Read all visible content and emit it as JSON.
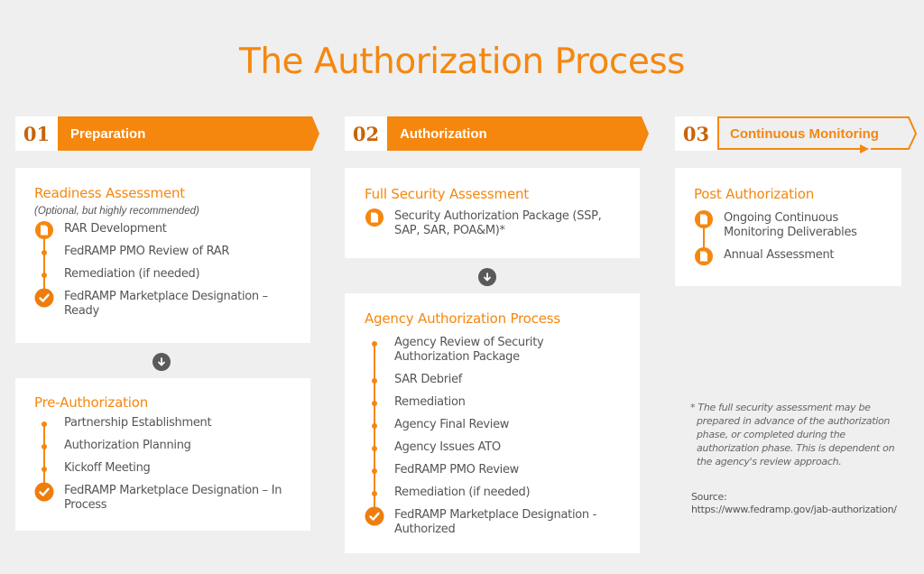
{
  "title": "The Authorization Process",
  "colors": {
    "accent": "#f5870f",
    "number": "#c8640a",
    "arrow": "#5a5a5a",
    "background": "#efefef"
  },
  "phases": [
    {
      "number": "01",
      "label": "Preparation",
      "style": "filled"
    },
    {
      "number": "02",
      "label": "Authorization",
      "style": "filled"
    },
    {
      "number": "03",
      "label": "Continuous Monitoring",
      "style": "outline"
    }
  ],
  "cards": {
    "readiness": {
      "title": "Readiness Assessment",
      "subtitle": "(Optional, but highly recommended)",
      "items": [
        {
          "icon": "document-icon",
          "text": "RAR Development"
        },
        {
          "icon": "dot-icon",
          "text": "FedRAMP PMO Review of RAR"
        },
        {
          "icon": "dot-icon",
          "text": "Remediation (if needed)"
        },
        {
          "icon": "check-icon",
          "text": "FedRAMP Marketplace Designation – Ready"
        }
      ]
    },
    "pre_authorization": {
      "title": "Pre-Authorization",
      "items": [
        {
          "icon": "dot-icon",
          "text": "Partnership Establishment"
        },
        {
          "icon": "dot-icon",
          "text": "Authorization Planning"
        },
        {
          "icon": "dot-icon",
          "text": "Kickoff Meeting"
        },
        {
          "icon": "check-icon",
          "text": "FedRAMP Marketplace Designation – In Process"
        }
      ]
    },
    "full_security": {
      "title": "Full Security Assessment",
      "items": [
        {
          "icon": "document-icon",
          "text": "Security Authorization Package (SSP, SAP, SAR, POA&M)*"
        }
      ]
    },
    "agency_authorization": {
      "title": "Agency Authorization Process",
      "items": [
        {
          "icon": "dot-icon",
          "text": "Agency Review of Security Authorization Package"
        },
        {
          "icon": "dot-icon",
          "text": "SAR Debrief"
        },
        {
          "icon": "dot-icon",
          "text": "Remediation"
        },
        {
          "icon": "dot-icon",
          "text": "Agency Final Review"
        },
        {
          "icon": "dot-icon",
          "text": "Agency Issues ATO"
        },
        {
          "icon": "dot-icon",
          "text": "FedRAMP PMO Review"
        },
        {
          "icon": "dot-icon",
          "text": "Remediation (if needed)"
        },
        {
          "icon": "check-icon",
          "text": "FedRAMP Marketplace Designation - Authorized"
        }
      ]
    },
    "post_authorization": {
      "title": "Post Authorization",
      "items": [
        {
          "icon": "document-icon",
          "text": "Ongoing Continuous Monitoring Deliverables"
        },
        {
          "icon": "document-icon",
          "text": "Annual Assessment"
        }
      ]
    }
  },
  "footnote": "* The full security assessment may be prepared in advance of the authorization phase, or completed during the authorization phase. This is dependent on the agency's review approach.",
  "source_label": "Source:",
  "source_url": "https://www.fedramp.gov/jab-authorization/"
}
